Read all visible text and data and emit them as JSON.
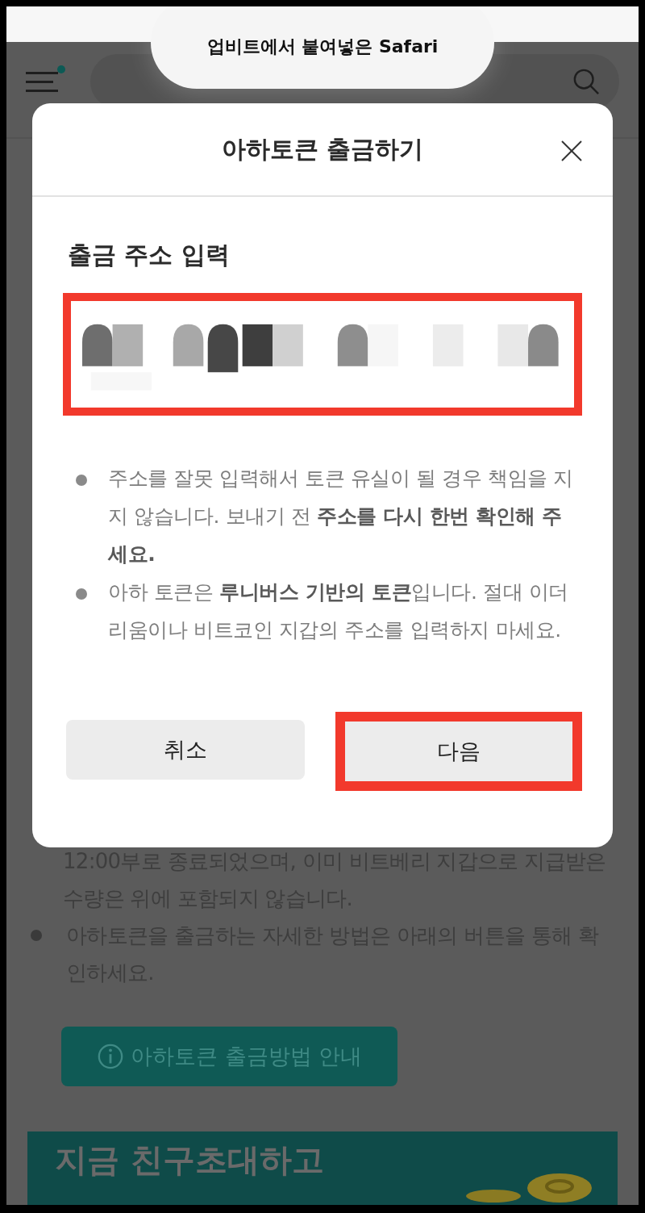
{
  "toast": {
    "text": "업비트에서 붙여넣은 Safari"
  },
  "background": {
    "notes": [
      {
        "kind": "continuation",
        "text": "12:00부로 종료되었으며, 이미 비트베리 지갑으로 지급받은 수량은 위에 포함되지 않습니다."
      },
      {
        "kind": "bullet",
        "text": "아하토큰을 출금하는 자세한 방법은 아래의 버튼을 통해 확인하세요."
      }
    ],
    "guide_button": {
      "label": "아하토큰 출금방법 안내"
    },
    "banner": {
      "title": "지금 친구초대하고"
    }
  },
  "modal": {
    "title": "아하토큰 출금하기",
    "section_title": "출금 주소 입력",
    "address_field": {
      "kind": "redacted",
      "highlighted": true
    },
    "notes": [
      "주소를 잘못 입력해서 토큰 유실이 될 경우 책임을 지지 않습니다. 보내기 전 **주소를 다시 한번 확인해 주세요.**",
      "아하 토큰은 **루니버스 기반의 토큰**입니다. 절대 이더리움이나 비트코인 지갑의 주소를 입력하지 마세요."
    ],
    "buttons": [
      {
        "label": "취소",
        "highlighted": false
      },
      {
        "label": "다음",
        "highlighted": true
      }
    ]
  }
}
